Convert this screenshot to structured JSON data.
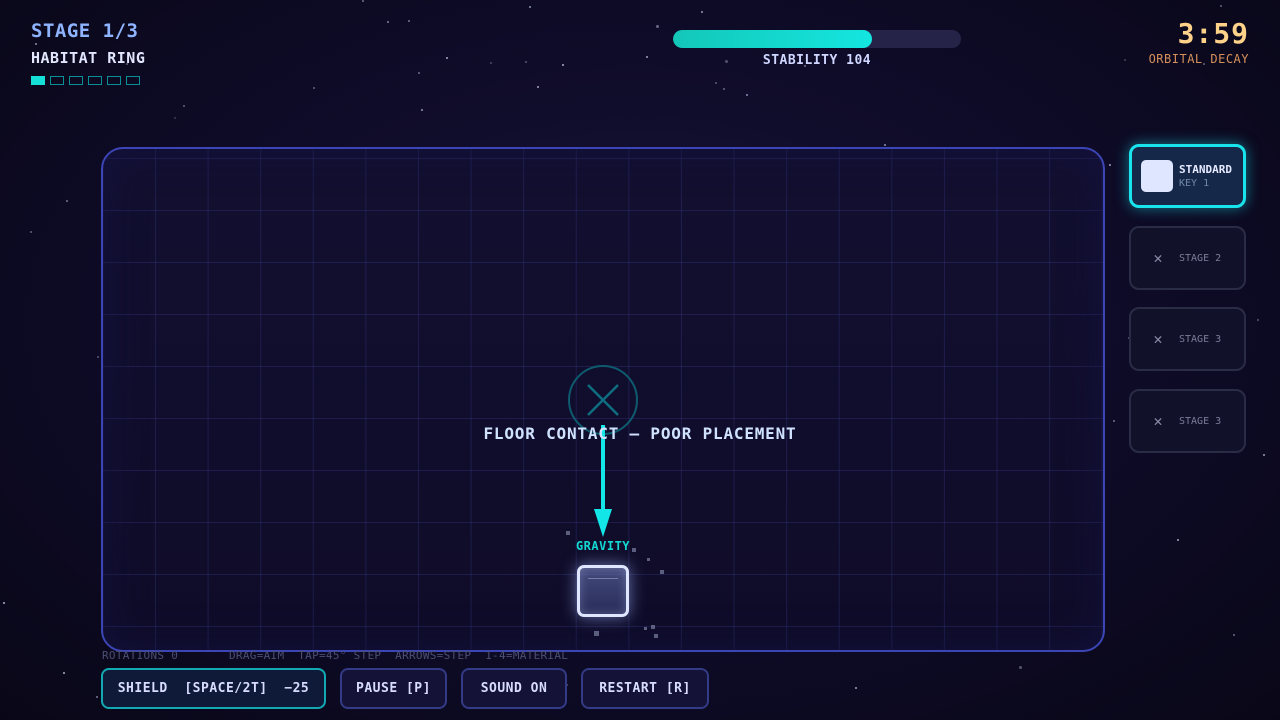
{
  "hud": {
    "stage_label": "STAGE 1/3",
    "stage_name": "HABITAT RING",
    "stage_progress": {
      "completed": 1,
      "total": 6
    },
    "stability_label": "STABILITY 104",
    "stability_fill": 0.69,
    "timer": "3:59",
    "timer_label": "ORBITAL DECAY"
  },
  "arena": {
    "message": "FLOOR CONTACT — POOR PLACEMENT",
    "gravity_label": "GRAVITY"
  },
  "hint": {
    "rotations": "ROTATIONS 0",
    "controls": "DRAG=AIM  TAP=45° STEP  ARROWS=STEP  1-4=MATERIAL"
  },
  "buttons": {
    "shield": "SHIELD  [SPACE/2T]  −25",
    "pause": "PAUSE [P]",
    "sound": "SOUND ON",
    "restart": "RESTART [R]"
  },
  "materials": [
    {
      "name": "STANDARD",
      "key": "KEY 1",
      "locked": false,
      "selected": true
    },
    {
      "name": "STAGE 2",
      "locked": true,
      "icon": "x-icon"
    },
    {
      "name": "STAGE 3",
      "locked": true,
      "icon": "x-icon"
    },
    {
      "name": "STAGE 3",
      "locked": true,
      "icon": "x-icon"
    }
  ],
  "colors": {
    "accent": "#14e0d8",
    "timer": "#ffd28a",
    "arena_border": "#3b45b6",
    "stage_title": "#8fb4ff"
  }
}
